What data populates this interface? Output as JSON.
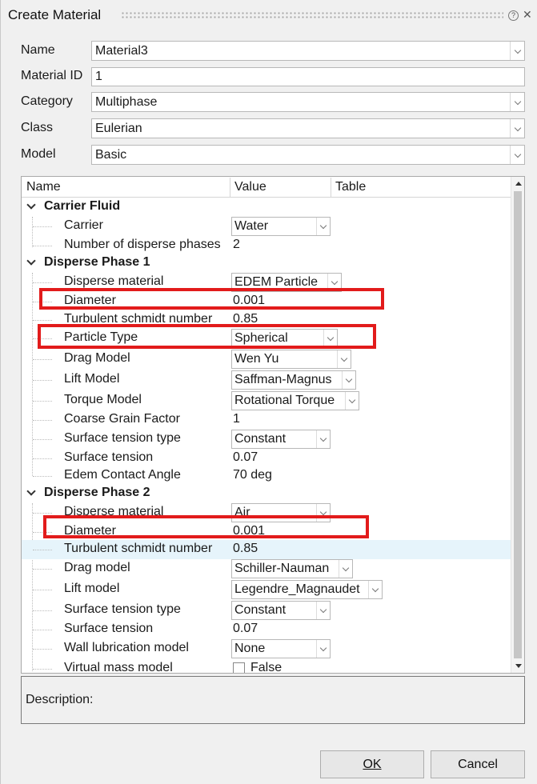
{
  "window": {
    "title": "Create Material"
  },
  "form": {
    "name": {
      "label": "Name",
      "value": "Material3"
    },
    "material_id": {
      "label": "Material ID",
      "value": "1"
    },
    "category": {
      "label": "Category",
      "value": "Multiphase"
    },
    "class": {
      "label": "Class",
      "value": "Eulerian"
    },
    "model": {
      "label": "Model",
      "value": "Basic"
    }
  },
  "tree": {
    "columns": [
      "Name",
      "Value",
      "Table"
    ],
    "carrier_fluid": {
      "label": "Carrier Fluid",
      "carrier": {
        "label": "Carrier",
        "value": "Water"
      },
      "num_phases": {
        "label": "Number of disperse phases",
        "value": "2"
      }
    },
    "phase1": {
      "label": "Disperse Phase 1",
      "material": {
        "label": "Disperse material",
        "value": "EDEM Particle"
      },
      "diameter": {
        "label": "Diameter",
        "value": "0.001"
      },
      "schmidt": {
        "label": "Turbulent schmidt number",
        "value": "0.85"
      },
      "particle_type": {
        "label": "Particle Type",
        "value": "Spherical"
      },
      "drag": {
        "label": "Drag Model",
        "value": "Wen Yu"
      },
      "lift": {
        "label": "Lift Model",
        "value": "Saffman-Magnus"
      },
      "torque": {
        "label": "Torque Model",
        "value": "Rotational Torque"
      },
      "coarse": {
        "label": "Coarse Grain Factor",
        "value": "1"
      },
      "tension_type": {
        "label": "Surface tension type",
        "value": "Constant"
      },
      "tension": {
        "label": "Surface tension",
        "value": "0.07"
      },
      "contact_angle": {
        "label": "Edem Contact Angle",
        "value": "70 deg"
      }
    },
    "phase2": {
      "label": "Disperse Phase 2",
      "material": {
        "label": "Disperse material",
        "value": "Air"
      },
      "diameter": {
        "label": "Diameter",
        "value": "0.001"
      },
      "schmidt": {
        "label": "Turbulent schmidt number",
        "value": "0.85"
      },
      "drag": {
        "label": "Drag model",
        "value": "Schiller-Nauman"
      },
      "lift": {
        "label": "Lift model",
        "value": "Legendre_Magnaudet"
      },
      "tension_type": {
        "label": "Surface tension type",
        "value": "Constant"
      },
      "tension": {
        "label": "Surface tension",
        "value": "0.07"
      },
      "wall_lub": {
        "label": "Wall lubrication model",
        "value": "None"
      },
      "virtual_mass": {
        "label": "Virtual mass model",
        "value": "False"
      }
    }
  },
  "description": {
    "label": "Description:"
  },
  "buttons": {
    "ok": "OK",
    "cancel": "Cancel"
  },
  "colors": {
    "highlight_box": "#e21b1b",
    "selected_row": "#e6f4fb"
  }
}
